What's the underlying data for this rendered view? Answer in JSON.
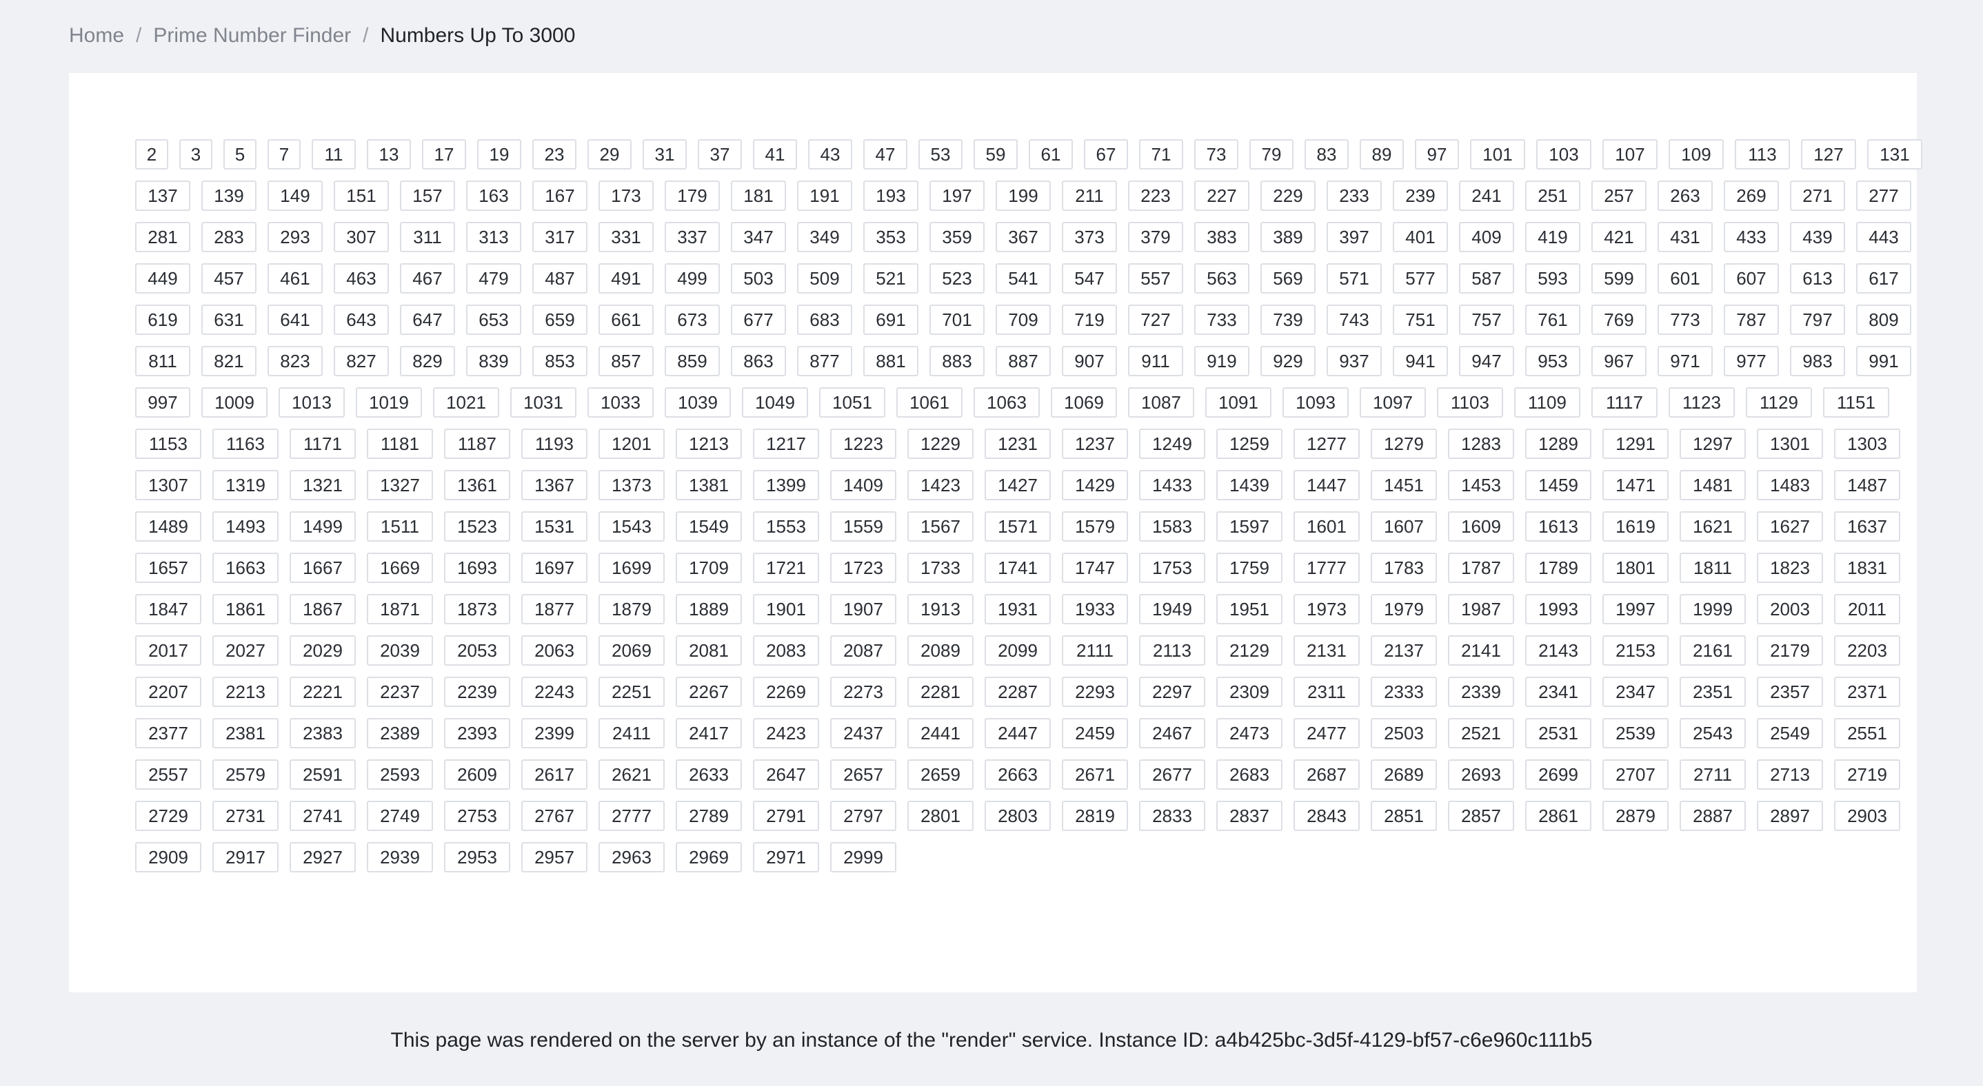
{
  "breadcrumb": {
    "home": "Home",
    "section": "Prime Number Finder",
    "current": "Numbers Up To 3000",
    "separator": "/"
  },
  "primes": [
    "2",
    "3",
    "5",
    "7",
    "11",
    "13",
    "17",
    "19",
    "23",
    "29",
    "31",
    "37",
    "41",
    "43",
    "47",
    "53",
    "59",
    "61",
    "67",
    "71",
    "73",
    "79",
    "83",
    "89",
    "97",
    "101",
    "103",
    "107",
    "109",
    "113",
    "127",
    "131",
    "137",
    "139",
    "149",
    "151",
    "157",
    "163",
    "167",
    "173",
    "179",
    "181",
    "191",
    "193",
    "197",
    "199",
    "211",
    "223",
    "227",
    "229",
    "233",
    "239",
    "241",
    "251",
    "257",
    "263",
    "269",
    "271",
    "277",
    "281",
    "283",
    "293",
    "307",
    "311",
    "313",
    "317",
    "331",
    "337",
    "347",
    "349",
    "353",
    "359",
    "367",
    "373",
    "379",
    "383",
    "389",
    "397",
    "401",
    "409",
    "419",
    "421",
    "431",
    "433",
    "439",
    "443",
    "449",
    "457",
    "461",
    "463",
    "467",
    "479",
    "487",
    "491",
    "499",
    "503",
    "509",
    "521",
    "523",
    "541",
    "547",
    "557",
    "563",
    "569",
    "571",
    "577",
    "587",
    "593",
    "599",
    "601",
    "607",
    "613",
    "617",
    "619",
    "631",
    "641",
    "643",
    "647",
    "653",
    "659",
    "661",
    "673",
    "677",
    "683",
    "691",
    "701",
    "709",
    "719",
    "727",
    "733",
    "739",
    "743",
    "751",
    "757",
    "761",
    "769",
    "773",
    "787",
    "797",
    "809",
    "811",
    "821",
    "823",
    "827",
    "829",
    "839",
    "853",
    "857",
    "859",
    "863",
    "877",
    "881",
    "883",
    "887",
    "907",
    "911",
    "919",
    "929",
    "937",
    "941",
    "947",
    "953",
    "967",
    "971",
    "977",
    "983",
    "991",
    "997",
    "1009",
    "1013",
    "1019",
    "1021",
    "1031",
    "1033",
    "1039",
    "1049",
    "1051",
    "1061",
    "1063",
    "1069",
    "1087",
    "1091",
    "1093",
    "1097",
    "1103",
    "1109",
    "1117",
    "1123",
    "1129",
    "1151",
    "1153",
    "1163",
    "1171",
    "1181",
    "1187",
    "1193",
    "1201",
    "1213",
    "1217",
    "1223",
    "1229",
    "1231",
    "1237",
    "1249",
    "1259",
    "1277",
    "1279",
    "1283",
    "1289",
    "1291",
    "1297",
    "1301",
    "1303",
    "1307",
    "1319",
    "1321",
    "1327",
    "1361",
    "1367",
    "1373",
    "1381",
    "1399",
    "1409",
    "1423",
    "1427",
    "1429",
    "1433",
    "1439",
    "1447",
    "1451",
    "1453",
    "1459",
    "1471",
    "1481",
    "1483",
    "1487",
    "1489",
    "1493",
    "1499",
    "1511",
    "1523",
    "1531",
    "1543",
    "1549",
    "1553",
    "1559",
    "1567",
    "1571",
    "1579",
    "1583",
    "1597",
    "1601",
    "1607",
    "1609",
    "1613",
    "1619",
    "1621",
    "1627",
    "1637",
    "1657",
    "1663",
    "1667",
    "1669",
    "1693",
    "1697",
    "1699",
    "1709",
    "1721",
    "1723",
    "1733",
    "1741",
    "1747",
    "1753",
    "1759",
    "1777",
    "1783",
    "1787",
    "1789",
    "1801",
    "1811",
    "1823",
    "1831",
    "1847",
    "1861",
    "1867",
    "1871",
    "1873",
    "1877",
    "1879",
    "1889",
    "1901",
    "1907",
    "1913",
    "1931",
    "1933",
    "1949",
    "1951",
    "1973",
    "1979",
    "1987",
    "1993",
    "1997",
    "1999",
    "2003",
    "2011",
    "2017",
    "2027",
    "2029",
    "2039",
    "2053",
    "2063",
    "2069",
    "2081",
    "2083",
    "2087",
    "2089",
    "2099",
    "2111",
    "2113",
    "2129",
    "2131",
    "2137",
    "2141",
    "2143",
    "2153",
    "2161",
    "2179",
    "2203",
    "2207",
    "2213",
    "2221",
    "2237",
    "2239",
    "2243",
    "2251",
    "2267",
    "2269",
    "2273",
    "2281",
    "2287",
    "2293",
    "2297",
    "2309",
    "2311",
    "2333",
    "2339",
    "2341",
    "2347",
    "2351",
    "2357",
    "2371",
    "2377",
    "2381",
    "2383",
    "2389",
    "2393",
    "2399",
    "2411",
    "2417",
    "2423",
    "2437",
    "2441",
    "2447",
    "2459",
    "2467",
    "2473",
    "2477",
    "2503",
    "2521",
    "2531",
    "2539",
    "2543",
    "2549",
    "2551",
    "2557",
    "2579",
    "2591",
    "2593",
    "2609",
    "2617",
    "2621",
    "2633",
    "2647",
    "2657",
    "2659",
    "2663",
    "2671",
    "2677",
    "2683",
    "2687",
    "2689",
    "2693",
    "2699",
    "2707",
    "2711",
    "2713",
    "2719",
    "2729",
    "2731",
    "2741",
    "2749",
    "2753",
    "2767",
    "2777",
    "2789",
    "2791",
    "2797",
    "2801",
    "2803",
    "2819",
    "2833",
    "2837",
    "2843",
    "2851",
    "2857",
    "2861",
    "2879",
    "2887",
    "2897",
    "2903",
    "2909",
    "2917",
    "2927",
    "2939",
    "2953",
    "2957",
    "2963",
    "2969",
    "2971",
    "2999"
  ],
  "footer": {
    "text": "This page was rendered on the server by an instance of the \"render\" service. Instance ID: a4b425bc-3d5f-4129-bf57-c6e960c111b5"
  }
}
